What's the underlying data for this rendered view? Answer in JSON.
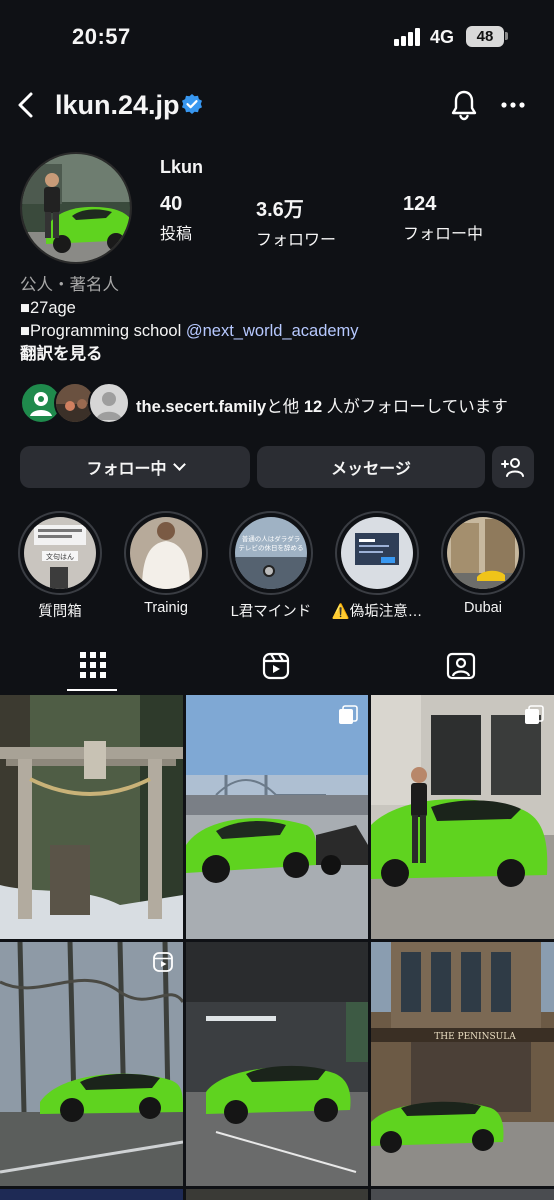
{
  "status_bar": {
    "time": "20:57",
    "network": "4G",
    "battery": "48"
  },
  "header": {
    "username": "lkun.24.jp"
  },
  "profile": {
    "display_name": "Lkun",
    "stats": [
      {
        "value": "40",
        "label": "投稿"
      },
      {
        "value": "3.6万",
        "label": "フォロワー"
      },
      {
        "value": "124",
        "label": "フォロー中"
      }
    ],
    "category": "公人・著名人",
    "bio_line1": "■27age",
    "bio_line2_prefix": "■Programming school ",
    "bio_link": "@next_world_academy",
    "translate": "翻訳を見る"
  },
  "followed_by": {
    "name": "the.secert.family",
    "suffix": "と他",
    "count": "12",
    "suffix2": "人がフォローしています"
  },
  "buttons": {
    "following": "フォロー中",
    "message": "メッセージ"
  },
  "highlights": [
    {
      "label": "質問箱"
    },
    {
      "label": "Trainig"
    },
    {
      "label": "L君マインド"
    },
    {
      "label": "⚠️偽垢注意…"
    },
    {
      "label": "Dubai"
    }
  ],
  "highlight_texts": {
    "h1_line1": "文句はん",
    "h3_line1": "普通の人はダラダラ",
    "h3_line2": "テレビの休日を辞める"
  },
  "grid_text": {
    "hotel_sign": "THE PENINSULA"
  },
  "colors": {
    "background": "#0f1115",
    "button": "#2b2d33",
    "link": "#b7c9ff",
    "verified": "#3897f0",
    "car_green": "#5fd31f"
  }
}
